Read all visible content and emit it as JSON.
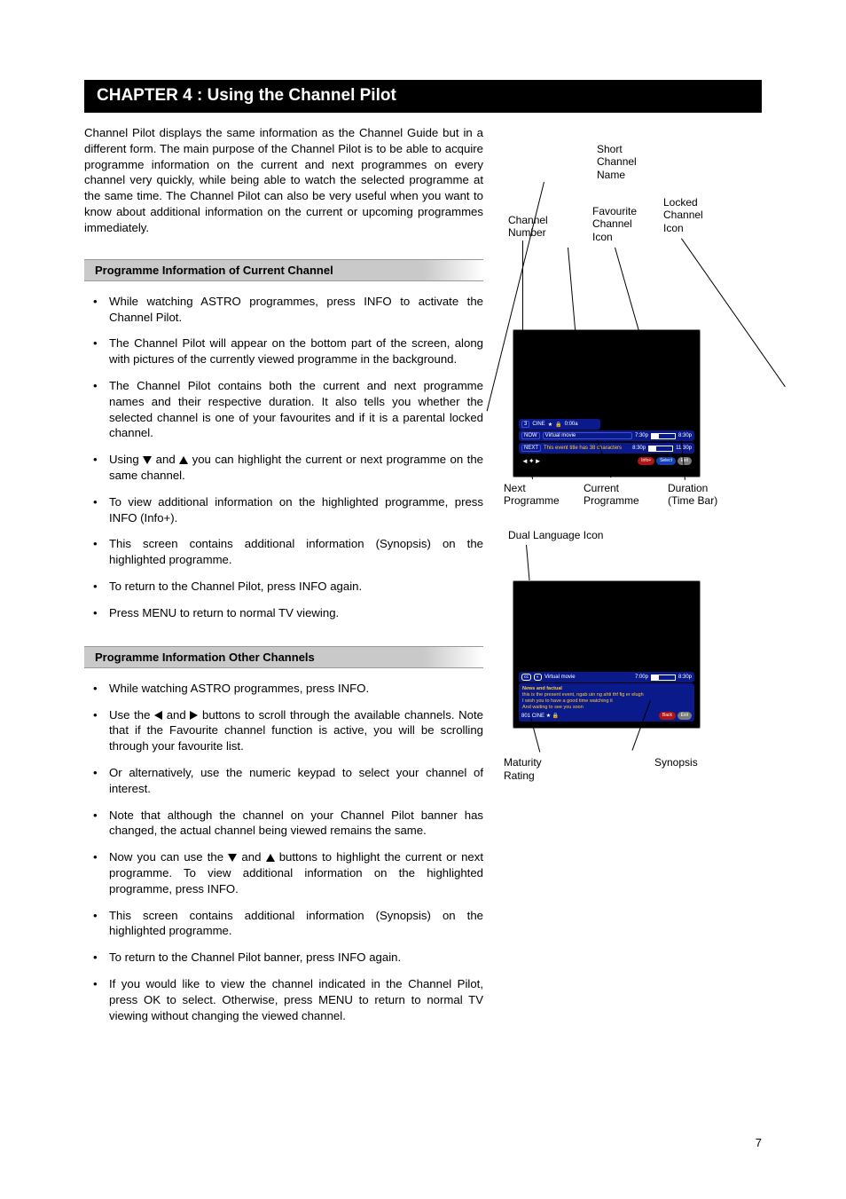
{
  "chapter_title": "CHAPTER 4 : Using the Channel Pilot",
  "intro": "Channel Pilot displays the same information as the Channel Guide but in a different form.  The main purpose of the Channel Pilot is to be able to acquire programme information on the current and next programmes on every channel very quickly, while being able to watch the selected programme at the same time.  The Channel Pilot can also be very useful when you want to know about additional information on the current or upcoming programmes immediately.",
  "section1": {
    "title": "Programme Information of Current Channel",
    "items": [
      "While watching ASTRO programmes, press INFO to activate the Channel Pilot.",
      "The Channel Pilot will appear on the bottom part of the screen, along with pictures of the currently viewed programme in the background.",
      "The Channel Pilot contains both the current and next programme names and their respective duration.  It also tells you whether the selected channel is one of your favourites and if it is a parental locked channel.",
      {
        "pre": "Using ",
        "mid": " and ",
        "post": " you can highlight the current or next programme on the same channel.",
        "icons": [
          "down",
          "up"
        ]
      },
      "To view additional information on the highlighted programme, press INFO (Info+).",
      "This screen contains additional information (Synopsis) on the highlighted programme.",
      "To return to the Channel Pilot, press INFO again.",
      "Press MENU to return to normal TV viewing."
    ]
  },
  "section2": {
    "title": "Programme Information Other Channels",
    "items": [
      "While watching ASTRO programmes, press INFO.",
      {
        "pre": "Use the  ",
        "mid": "  and  ",
        "post": "  buttons to scroll through the available channels.  Note that if the Favourite channel function is active, you will be scrolling through your favourite list.",
        "icons": [
          "left",
          "right"
        ]
      },
      "Or alternatively, use the numeric keypad to select your channel of interest.",
      "Note that although the channel on your Channel Pilot banner has changed, the actual channel being viewed remains the same.",
      {
        "pre": "Now you can use the ",
        "mid": " and ",
        "post": " buttons to highlight the current or next programme. To view additional information on the highlighted programme, press INFO.",
        "icons": [
          "down",
          "up"
        ]
      },
      "This screen contains additional information (Synopsis) on the highlighted programme.",
      "To return to the Channel Pilot banner, press INFO again.",
      "If you would like to view the channel indicated in the Channel Pilot, press OK to select.  Otherwise, press MENU to return to normal TV viewing without changing the viewed channel."
    ]
  },
  "fig1": {
    "labels": {
      "short_channel_name": "Short\nChannel\nName",
      "channel_number": "Channel\nNumber",
      "favourite_icon": "Favourite\nChannel\nIcon",
      "locked_icon": "Locked\nChannel\nIcon",
      "next_programme": "Next\nProgramme",
      "current_programme": "Current\nProgramme",
      "duration": "Duration\n(Time Bar)"
    },
    "banner": {
      "ch_num": "3",
      "ch_name": "CINE",
      "time": "0:00a",
      "now_label": "NOW",
      "now_title": "Virtual movie",
      "now_start": "7:30p",
      "now_end": "8:30p",
      "next_label": "NEXT",
      "next_title": "This event title has 38 characters",
      "next_start": "8:30p",
      "next_end": "11:30p",
      "btn_info": "Info+",
      "btn_select": "Select",
      "btn_exit": "Exit"
    }
  },
  "fig2": {
    "labels": {
      "dual_lang": "Dual Language Icon",
      "maturity": "Maturity\nRating",
      "synopsis": "Synopsis"
    },
    "banner": {
      "title": "Virtual movie",
      "start": "7:00p",
      "end": "8:30p",
      "syn_head": "News and factual",
      "syn_l1": "this is the present event, ngab uin ng ahti thf fig er elugh",
      "syn_l2": "I wish you to have a good time watching it",
      "syn_l3": "And waiting to see you soon",
      "rating": "801",
      "ch_name": "CINE",
      "btn_back": "Back",
      "btn_exit": "Exit"
    }
  },
  "page_number": "7"
}
